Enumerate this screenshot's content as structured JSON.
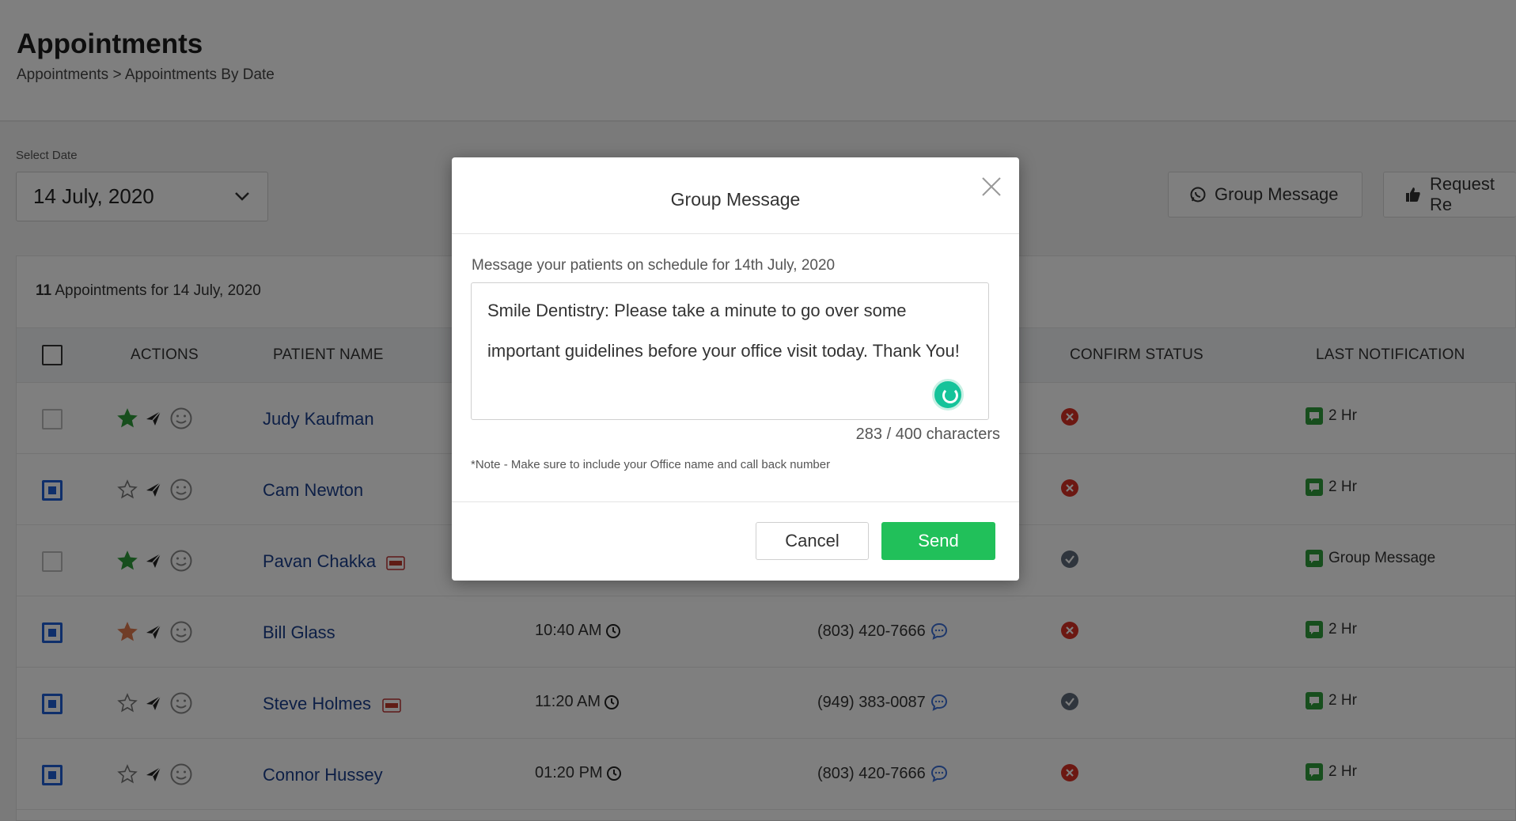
{
  "header": {
    "title": "Appointments",
    "breadcrumb": [
      "Appointments",
      ">",
      "Appointments By Date"
    ]
  },
  "date_selector": {
    "label": "Select Date",
    "value": "14 July, 2020"
  },
  "toolbar": {
    "group_message_label": "Group Message",
    "request_review_label": "Request Re"
  },
  "list": {
    "count": "11",
    "count_suffix": "Appointments for 14 July, 2020",
    "columns": {
      "actions": "ACTIONS",
      "patient_name": "PATIENT NAME",
      "confirm_status": "CONFIRM STATUS",
      "last_notification": "LAST NOTIFICATION"
    },
    "rows": [
      {
        "checked": false,
        "star": "filled-green",
        "name": "Judy Kaufman",
        "pdf": false,
        "time": "",
        "phone": "",
        "status": "declined",
        "notification": "2 Hr"
      },
      {
        "checked": true,
        "star": "outline",
        "name": "Cam Newton",
        "pdf": false,
        "time": "",
        "phone": "",
        "status": "declined",
        "notification": "2 Hr"
      },
      {
        "checked": false,
        "star": "filled-green",
        "name": "Pavan Chakka",
        "pdf": true,
        "time": "",
        "phone": "",
        "status": "confirmed",
        "notification": "Group Message"
      },
      {
        "checked": true,
        "star": "filled-orange",
        "name": "Bill Glass",
        "pdf": false,
        "time": "10:40 AM",
        "phone": "(803) 420-7666",
        "status": "declined",
        "notification": "2 Hr"
      },
      {
        "checked": true,
        "star": "outline",
        "name": "Steve Holmes",
        "pdf": true,
        "time": "11:20 AM",
        "phone": "(949) 383-0087",
        "status": "confirmed",
        "notification": "2 Hr"
      },
      {
        "checked": true,
        "star": "outline",
        "name": "Connor Hussey",
        "pdf": false,
        "time": "01:20 PM",
        "phone": "(803) 420-7666",
        "status": "declined",
        "notification": "2 Hr"
      }
    ]
  },
  "modal": {
    "title": "Group Message",
    "intro": "Message your patients on schedule for 14th July, 2020",
    "message": "Smile Dentistry: Please take a minute to go over some important guidelines before your office visit today. Thank You!",
    "char_count": "283 / 400 characters",
    "note": "*Note - Make sure to include your Office name and call back number",
    "cancel_label": "Cancel",
    "send_label": "Send"
  },
  "colors": {
    "accent_green": "#21c05a",
    "link_blue": "#1a3e8c",
    "checkbox_blue": "#1f5fd6",
    "declined_red": "#d93025",
    "confirmed_gray": "#5f6b7a"
  }
}
